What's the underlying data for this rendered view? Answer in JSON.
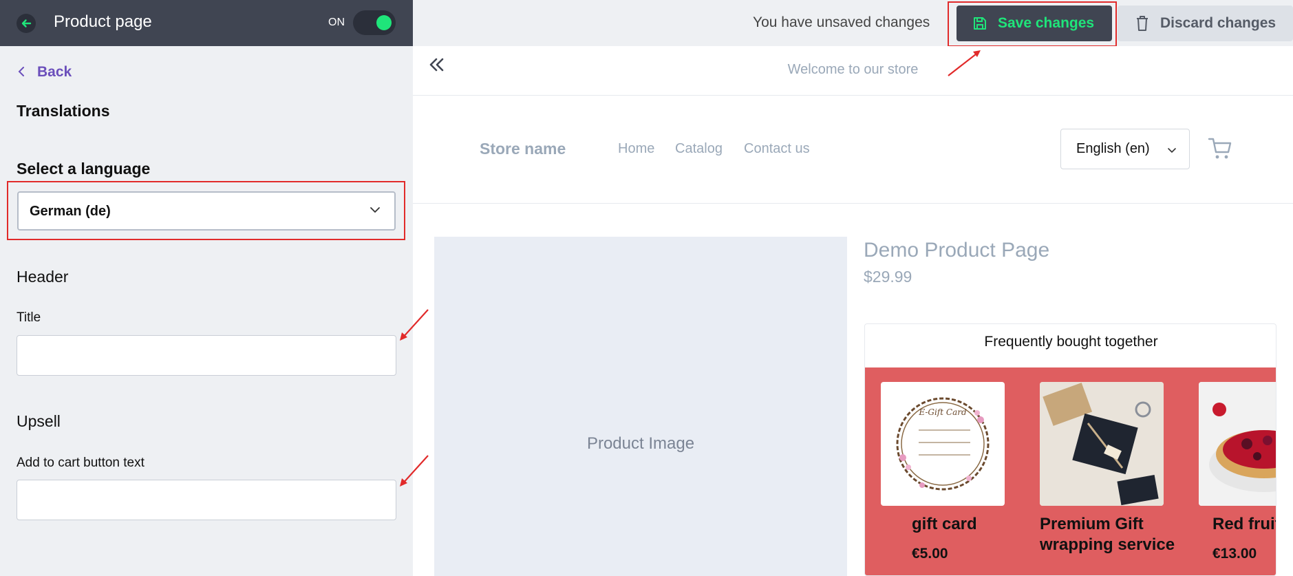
{
  "sidebar": {
    "title": "Product page",
    "toggle_label": "ON",
    "back_label": "Back",
    "section_translations": "Translations",
    "select_language_label": "Select a language",
    "selected_language": "German (de)",
    "header_section": "Header",
    "title_label": "Title",
    "title_value": "",
    "upsell_section": "Upsell",
    "add_to_cart_label": "Add to cart button text",
    "add_to_cart_value": ""
  },
  "topbar": {
    "unsaved_text": "You have unsaved changes",
    "save_label": "Save changes",
    "discard_label": "Discard changes"
  },
  "store": {
    "announcement": "Welcome to our store",
    "name": "Store name",
    "nav": [
      "Home",
      "Catalog",
      "Contact us"
    ],
    "language": "English (en)",
    "product_image_placeholder": "Product Image",
    "product_title": "Demo Product Page",
    "product_price": "$29.99",
    "fbt_title": "Frequently bought together",
    "fbt_items": [
      {
        "name": "gift card",
        "price": "€5.00"
      },
      {
        "name": "Premium Gift wrapping service",
        "price": ""
      },
      {
        "name": "Red fruit",
        "price": "€13.00"
      }
    ]
  },
  "colors": {
    "accent_green": "#1fe57a",
    "annotation_red": "#e12a2a",
    "fbt_band": "#df5e60",
    "link_purple": "#6b4fbb"
  }
}
